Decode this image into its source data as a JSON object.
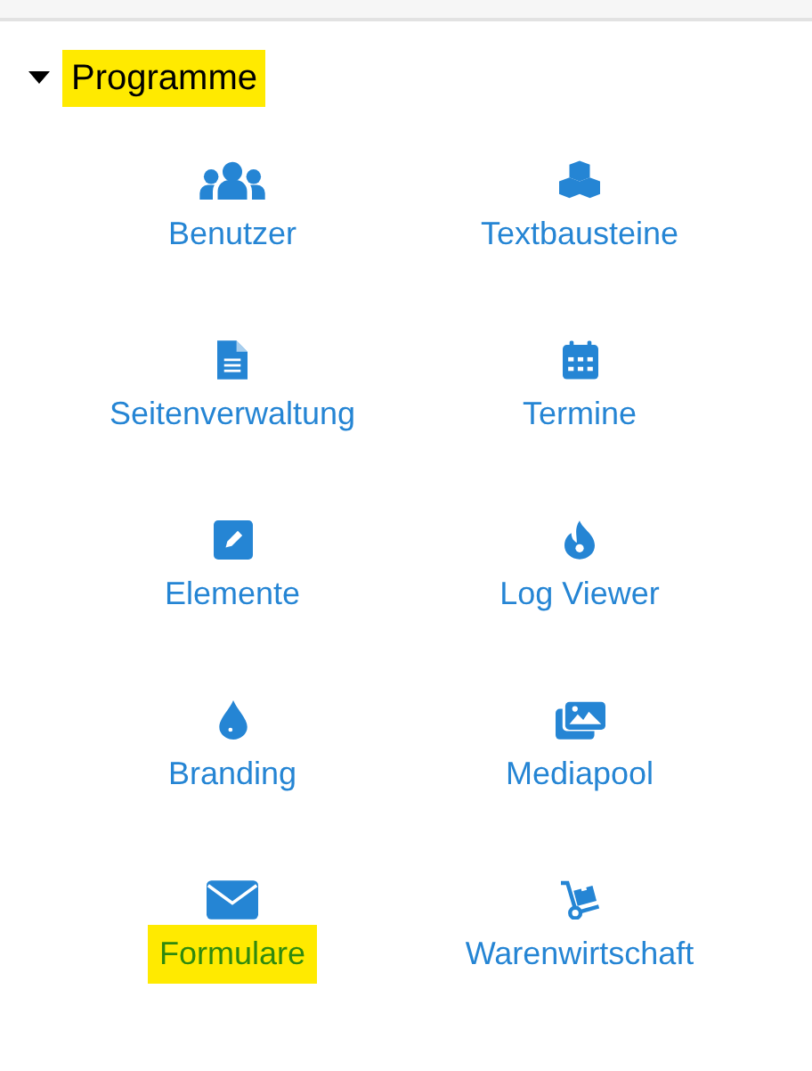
{
  "section": {
    "title": "Programme",
    "expanded": true,
    "highlighted": true
  },
  "items": [
    {
      "label": "Benutzer",
      "highlighted": false
    },
    {
      "label": "Textbausteine",
      "highlighted": false
    },
    {
      "label": "Seitenverwaltung",
      "highlighted": false
    },
    {
      "label": "Termine",
      "highlighted": false
    },
    {
      "label": "Elemente",
      "highlighted": false
    },
    {
      "label": "Log Viewer",
      "highlighted": false
    },
    {
      "label": "Branding",
      "highlighted": false
    },
    {
      "label": "Mediapool",
      "highlighted": false
    },
    {
      "label": "Formulare",
      "highlighted": true
    },
    {
      "label": "Warenwirtschaft",
      "highlighted": false
    }
  ]
}
